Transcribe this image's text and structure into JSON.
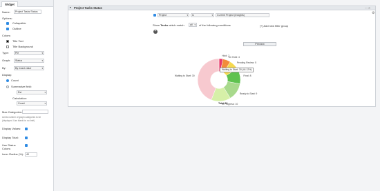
{
  "left_panel": {
    "tab": "Widget",
    "name_label": "Name:",
    "name_value": "Project Tasks Status",
    "options_label": "Options:",
    "collapsible": "Collapsible",
    "outline": "Outline",
    "colors_label": "Colors:",
    "title_text": "Title Text",
    "title_background": "Title Background",
    "type_label": "Type:",
    "type_value": "Pie",
    "graph_label": "Graph:",
    "graph_value": "Status",
    "by_label": "By:",
    "by_value": "By exact value",
    "display_label": "Display:",
    "count": "Count",
    "summarize": "Summarize field:",
    "field_value": "Est",
    "calculation_label": "Calculation:",
    "calculation_value": "Count",
    "max_categories": "Max Categories:",
    "max_note_1": "Limits number of graph categories to be",
    "max_note_2": "(displayed. Use blank for no limit)",
    "display_values": "Display Values:",
    "display_total": "Display Total:",
    "use_status_colors_1": "Use Status",
    "use_status_colors_2": "Colors:",
    "inner_radius": "Inner Radius (%):",
    "inner_radius_value": "40"
  },
  "panel": {
    "title": "Project Tasks Status",
    "filter_field": "Project",
    "filter_operator": "is",
    "filter_value": "Current Project (Insights)",
    "show_tasks_prefix": "Show",
    "show_tasks_bold": "Tasks",
    "show_tasks_which": "which match",
    "match_value": "all",
    "show_tasks_suffix": "of the following conditions",
    "add_filter_group": "[+] Add new filter group",
    "preview": "Preview"
  },
  "chart_data": {
    "type": "pie",
    "inner_radius_pct": 40,
    "total_label": "Total 68",
    "tooltip": "Waiting to Start: 30 (44.12%)",
    "slices": [
      {
        "label": "Hold",
        "value": 2,
        "text": "Hold: 2",
        "color": "#e83a6b"
      },
      {
        "label": "On Hold",
        "value": 4,
        "text": "On Hold: 4",
        "color": "#f28c3b"
      },
      {
        "label": "Pending Review",
        "value": 5,
        "text": "Pending Review: 5",
        "color": "#f5d84e"
      },
      {
        "label": "Final",
        "value": 8,
        "text": "Final: 8",
        "color": "#5fc24f"
      },
      {
        "label": "Ready to Start",
        "value": 9,
        "text": "Ready to Start: 9",
        "color": "#a8d98c"
      },
      {
        "label": "In Progress",
        "value": 10,
        "text": "In Progress: 10",
        "color": "#d6f0a8"
      },
      {
        "label": "Waiting to Start",
        "value": 30,
        "text": "Waiting to Start: 30",
        "color": "#f7c9cf"
      }
    ]
  }
}
